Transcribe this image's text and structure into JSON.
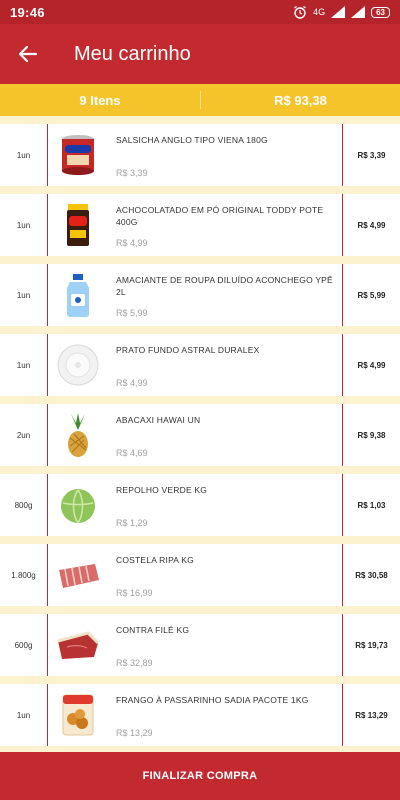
{
  "status": {
    "time": "19:46",
    "network": "4G",
    "battery": "63"
  },
  "header": {
    "title": "Meu carrinho"
  },
  "summary": {
    "count": "9 Itens",
    "total": "R$ 93,38"
  },
  "items": [
    {
      "qty": "1un",
      "name": "SALSICHA ANGLO TIPO VIENA 180G",
      "unit_price": "R$ 3,39",
      "total": "R$ 3,39",
      "icon": "sausage-can"
    },
    {
      "qty": "1un",
      "name": "ACHOCOLATADO EM PÓ ORIGINAL TODDY POTE 400G",
      "unit_price": "R$ 4,99",
      "total": "R$ 4,99",
      "icon": "chocolate-jar"
    },
    {
      "qty": "1un",
      "name": "AMACIANTE DE ROUPA DILUÍDO ACONCHEGO YPÊ 2L",
      "unit_price": "R$ 5,99",
      "total": "R$ 5,99",
      "icon": "softener-bottle"
    },
    {
      "qty": "1un",
      "name": "PRATO FUNDO ASTRAL DURALEX",
      "unit_price": "R$ 4,99",
      "total": "R$ 4,99",
      "icon": "plate"
    },
    {
      "qty": "2un",
      "name": "ABACAXI HAWAI UN",
      "unit_price": "R$ 4,69",
      "total": "R$ 9,38",
      "icon": "pineapple"
    },
    {
      "qty": "800g",
      "name": "REPOLHO VERDE KG",
      "unit_price": "R$ 1,29",
      "total": "R$ 1,03",
      "icon": "cabbage"
    },
    {
      "qty": "1.800g",
      "name": "COSTELA RIPA KG",
      "unit_price": "R$ 16,99",
      "total": "R$ 30,58",
      "icon": "ribs"
    },
    {
      "qty": "600g",
      "name": "CONTRA FILÉ KG",
      "unit_price": "R$ 32,89",
      "total": "R$ 19,73",
      "icon": "beef"
    },
    {
      "qty": "1un",
      "name": "FRANGO À PASSARINHO SADIA PACOTE 1KG",
      "unit_price": "R$ 13,29",
      "total": "R$ 13,29",
      "icon": "chicken-pack"
    }
  ],
  "checkout": {
    "label": "FINALIZAR COMPRA"
  }
}
